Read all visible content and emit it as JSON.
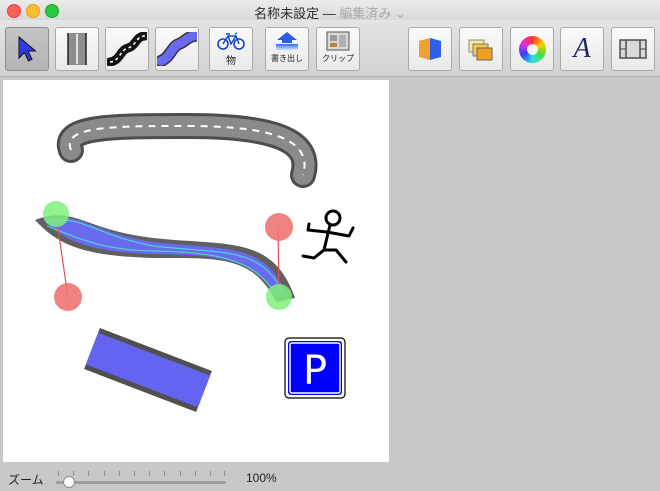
{
  "window": {
    "title": "名称未設定",
    "separator": "—",
    "status": "編集済み",
    "status_chevron": "⌄"
  },
  "toolbar": {
    "tools": [
      {
        "icon": "select-arrow-icon",
        "selected": true
      },
      {
        "icon": "straight-road-icon"
      },
      {
        "icon": "curved-road-icon"
      },
      {
        "icon": "river-icon"
      },
      {
        "icon": "bicycle-icon",
        "label": "物"
      },
      {
        "icon": "export-icon",
        "label": "書き出し"
      },
      {
        "icon": "clip-icon",
        "label": "クリップ"
      }
    ],
    "panels": [
      {
        "icon": "inspector-icon"
      },
      {
        "icon": "layers-icon"
      },
      {
        "icon": "color-wheel-icon"
      },
      {
        "icon": "font-icon",
        "glyph": "A"
      },
      {
        "icon": "film-strip-icon"
      }
    ]
  },
  "canvas": {
    "parking_sign": "P"
  },
  "zoom": {
    "label": "ズーム",
    "value": "100%",
    "level_percent": 100
  },
  "colors": {
    "road_gray": "#8a8a8a",
    "river_fill": "#6a6af0",
    "handle_green": "#7cf07c",
    "handle_red": "#f07474",
    "sign_blue": "#0000ff"
  }
}
